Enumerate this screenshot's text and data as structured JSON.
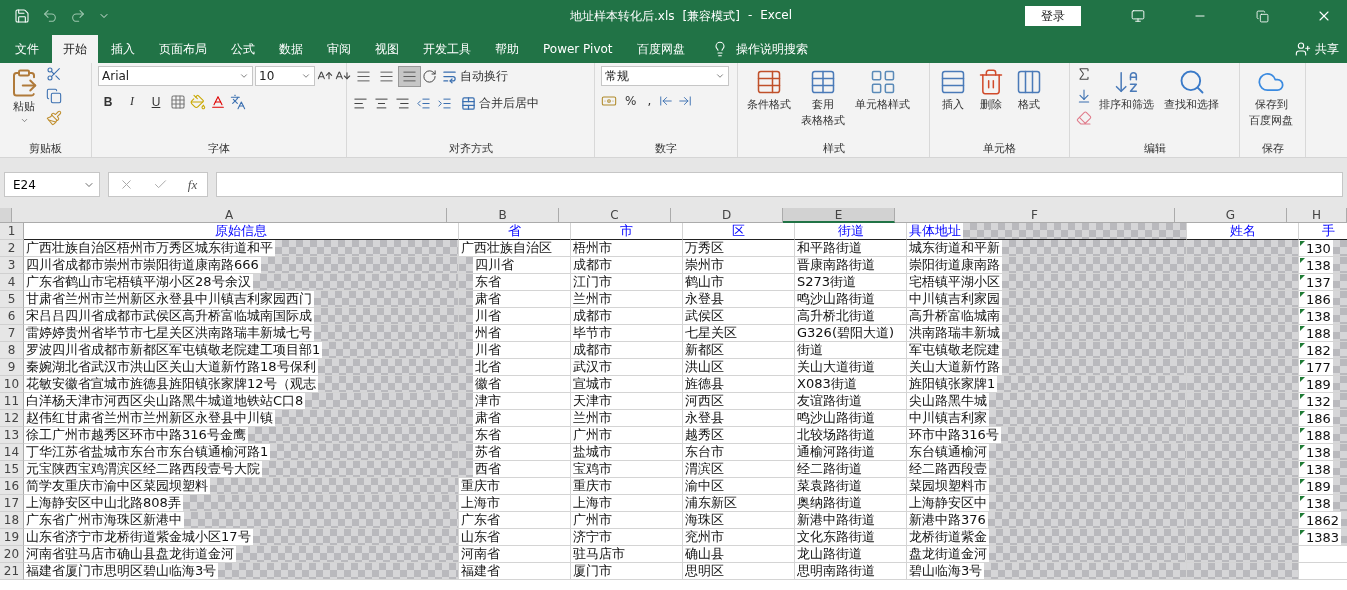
{
  "title_bar": {
    "file_name": "地址样本转化后.xls",
    "mode": "[兼容模式]",
    "separator": "-",
    "app": "Excel",
    "sign_in": "登录"
  },
  "tabs": [
    {
      "label": "文件",
      "selected": false
    },
    {
      "label": "开始",
      "selected": true
    },
    {
      "label": "插入",
      "selected": false
    },
    {
      "label": "页面布局",
      "selected": false
    },
    {
      "label": "公式",
      "selected": false
    },
    {
      "label": "数据",
      "selected": false
    },
    {
      "label": "审阅",
      "selected": false
    },
    {
      "label": "视图",
      "selected": false
    },
    {
      "label": "开发工具",
      "selected": false
    },
    {
      "label": "帮助",
      "selected": false
    },
    {
      "label": "Power Pivot",
      "selected": false
    },
    {
      "label": "百度网盘",
      "selected": false
    }
  ],
  "tell_me": "操作说明搜索",
  "share": "共享",
  "clipboard": {
    "title": "剪贴板",
    "paste": "粘贴"
  },
  "font": {
    "title": "字体",
    "name": "Arial",
    "size": "10",
    "bold": "B",
    "italic": "I",
    "underline": "U"
  },
  "alignment": {
    "title": "对齐方式",
    "wrap": "自动换行",
    "merge": "合并后居中",
    "vertical_buttons": [
      {
        "selected": false
      },
      {
        "selected": false
      },
      {
        "selected": true
      }
    ]
  },
  "number": {
    "title": "数字",
    "format": "常规",
    "percent": "%",
    "comma": ","
  },
  "styles": {
    "title": "样式",
    "buttons": [
      {
        "lines": [
          "条件格式"
        ]
      },
      {
        "lines": [
          "套用",
          "表格格式"
        ]
      },
      {
        "lines": [
          "单元格样式"
        ]
      }
    ]
  },
  "cells": {
    "title": "单元格",
    "buttons": [
      "插入",
      "删除",
      "格式"
    ]
  },
  "editing": {
    "title": "编辑",
    "buttons": [
      "排序和筛选",
      "查找和选择"
    ]
  },
  "save": {
    "title": "保存",
    "lines": [
      "保存到",
      "百度网盘"
    ]
  },
  "formula_bar": {
    "name_box": "E24",
    "fx": "fx"
  },
  "sheet": {
    "columns": [
      {
        "label": "A",
        "selected": false
      },
      {
        "label": "B",
        "selected": false
      },
      {
        "label": "C",
        "selected": false
      },
      {
        "label": "D",
        "selected": false
      },
      {
        "label": "E",
        "selected": true
      },
      {
        "label": "F",
        "selected": false
      },
      {
        "label": "G",
        "selected": false
      },
      {
        "label": "H",
        "selected": false
      }
    ],
    "rows": [
      {
        "num": "1",
        "cells": [
          {
            "text": "原始信息"
          },
          {
            "text": "省"
          },
          {
            "text": "市"
          },
          {
            "text": "区"
          },
          {
            "text": "街道"
          },
          {
            "text": "具体地址",
            "redacted": true
          },
          {
            "text": "姓名"
          },
          {
            "text": "手"
          }
        ]
      },
      {
        "num": "2",
        "cells": [
          {
            "text": "广西壮族自治区梧州市万秀区城东街道和平",
            "redacted": true
          },
          {
            "text": "广西壮族自治区"
          },
          {
            "text": "梧州市"
          },
          {
            "text": "万秀区"
          },
          {
            "text": "和平路街道"
          },
          {
            "text": "城东街道和平新",
            "redacted": true
          },
          {
            "redacted": true
          },
          {
            "text": "130",
            "redacted": true
          }
        ]
      },
      {
        "num": "3",
        "cells": [
          {
            "text": "四川省成都市崇州市崇阳街道康南路666",
            "redacted": true
          },
          {
            "text": "四川省",
            "redacted": true
          },
          {
            "text": "成都市"
          },
          {
            "text": "崇州市"
          },
          {
            "text": "晋康南路街道"
          },
          {
            "text": "崇阳街道康南路",
            "redacted": true
          },
          {
            "redacted": true
          },
          {
            "text": "138",
            "redacted": true
          }
        ]
      },
      {
        "num": "4",
        "cells": [
          {
            "text": "广东省鹤山市宅梧镇平湖小区28号余汉",
            "redacted": true
          },
          {
            "text": "东省",
            "redacted": true
          },
          {
            "text": "江门市"
          },
          {
            "text": "鹤山市"
          },
          {
            "text": "S273街道"
          },
          {
            "text": "宅梧镇平湖小区",
            "redacted": true
          },
          {
            "redacted": true
          },
          {
            "text": "137",
            "redacted": true
          }
        ]
      },
      {
        "num": "5",
        "cells": [
          {
            "text": "甘肃省兰州市兰州新区永登县中川镇吉利家园西门",
            "redacted": true
          },
          {
            "text": "肃省",
            "redacted": true
          },
          {
            "text": "兰州市"
          },
          {
            "text": "永登县"
          },
          {
            "text": "鸣沙山路街道"
          },
          {
            "text": "中川镇吉利家园",
            "redacted": true
          },
          {
            "redacted": true
          },
          {
            "text": "186",
            "redacted": true
          }
        ]
      },
      {
        "num": "6",
        "cells": [
          {
            "text": "宋吕吕四川省成都市武侯区高升桥富临城南国际成",
            "redacted": true
          },
          {
            "text": "川省",
            "redacted": true
          },
          {
            "text": "成都市"
          },
          {
            "text": "武侯区"
          },
          {
            "text": "高升桥北街道"
          },
          {
            "text": "高升桥富临城南",
            "redacted": true
          },
          {
            "redacted": true
          },
          {
            "text": "138",
            "redacted": true
          }
        ]
      },
      {
        "num": "7",
        "cells": [
          {
            "text": "雷婷婷贵州省毕节市七星关区洪南路瑞丰新城七号",
            "redacted": true
          },
          {
            "text": "州省",
            "redacted": true
          },
          {
            "text": "毕节市"
          },
          {
            "text": "七星关区"
          },
          {
            "text": "G326(碧阳大道)"
          },
          {
            "text": "洪南路瑞丰新城",
            "redacted": true
          },
          {
            "redacted": true
          },
          {
            "text": "188",
            "redacted": true
          }
        ]
      },
      {
        "num": "8",
        "cells": [
          {
            "text": "罗波四川省成都市新都区军屯镇敬老院建工项目部1",
            "redacted": true
          },
          {
            "text": "川省",
            "redacted": true
          },
          {
            "text": "成都市"
          },
          {
            "text": "新都区"
          },
          {
            "text": "街道"
          },
          {
            "text": "军屯镇敬老院建",
            "redacted": true
          },
          {
            "redacted": true
          },
          {
            "text": "182",
            "redacted": true
          }
        ]
      },
      {
        "num": "9",
        "cells": [
          {
            "text": "秦婉湖北省武汉市洪山区关山大道新竹路18号保利",
            "redacted": true
          },
          {
            "text": "北省",
            "redacted": true
          },
          {
            "text": "武汉市"
          },
          {
            "text": "洪山区"
          },
          {
            "text": "关山大道街道"
          },
          {
            "text": "关山大道新竹路",
            "redacted": true
          },
          {
            "redacted": true
          },
          {
            "text": "177",
            "redacted": true
          }
        ]
      },
      {
        "num": "10",
        "cells": [
          {
            "text": "花敏安徽省宣城市旌德县旌阳镇张家牌12号（观志",
            "redacted": true
          },
          {
            "text": "徽省",
            "redacted": true
          },
          {
            "text": "宣城市"
          },
          {
            "text": "旌德县"
          },
          {
            "text": "X083街道"
          },
          {
            "text": "旌阳镇张家牌1",
            "redacted": true
          },
          {
            "redacted": true
          },
          {
            "text": "189",
            "redacted": true
          }
        ]
      },
      {
        "num": "11",
        "cells": [
          {
            "text": "白洋杨天津市河西区尖山路黑牛城道地铁站C口8",
            "redacted": true
          },
          {
            "text": "津市",
            "redacted": true
          },
          {
            "text": "天津市"
          },
          {
            "text": "河西区"
          },
          {
            "text": "友谊路街道"
          },
          {
            "text": "尖山路黑牛城",
            "redacted": true
          },
          {
            "redacted": true
          },
          {
            "text": "132",
            "redacted": true
          }
        ]
      },
      {
        "num": "12",
        "cells": [
          {
            "text": "赵伟红甘肃省兰州市兰州新区永登县中川镇",
            "redacted": true
          },
          {
            "text": "肃省",
            "redacted": true
          },
          {
            "text": "兰州市"
          },
          {
            "text": "永登县"
          },
          {
            "text": "鸣沙山路街道"
          },
          {
            "text": "中川镇吉利家",
            "redacted": true
          },
          {
            "redacted": true
          },
          {
            "text": "186",
            "redacted": true
          }
        ]
      },
      {
        "num": "13",
        "cells": [
          {
            "text": "徐工广州市越秀区环市中路316号金鹰",
            "redacted": true
          },
          {
            "text": "东省",
            "redacted": true
          },
          {
            "text": "广州市"
          },
          {
            "text": "越秀区"
          },
          {
            "text": "北较场路街道"
          },
          {
            "text": "环市中路316号",
            "redacted": true
          },
          {
            "redacted": true
          },
          {
            "text": "188",
            "redacted": true
          }
        ]
      },
      {
        "num": "14",
        "cells": [
          {
            "text": "丁华江苏省盐城市东台市东台镇通榆河路1",
            "redacted": true
          },
          {
            "text": "苏省",
            "redacted": true
          },
          {
            "text": "盐城市"
          },
          {
            "text": "东台市"
          },
          {
            "text": "通榆河路街道"
          },
          {
            "text": "东台镇通榆河",
            "redacted": true
          },
          {
            "redacted": true
          },
          {
            "text": "138",
            "redacted": true
          }
        ]
      },
      {
        "num": "15",
        "cells": [
          {
            "text": "元宝陕西宝鸡渭滨区经二路西段壹号大院",
            "redacted": true
          },
          {
            "text": "西省",
            "redacted": true
          },
          {
            "text": "宝鸡市"
          },
          {
            "text": "渭滨区"
          },
          {
            "text": "经二路街道"
          },
          {
            "text": "经二路西段壹",
            "redacted": true
          },
          {
            "redacted": true
          },
          {
            "text": "138",
            "redacted": true
          }
        ]
      },
      {
        "num": "16",
        "cells": [
          {
            "text": "简学友重庆市渝中区菜园坝塑料",
            "redacted": true
          },
          {
            "text": "重庆市"
          },
          {
            "text": "重庆市"
          },
          {
            "text": "渝中区"
          },
          {
            "text": "菜袁路街道"
          },
          {
            "text": "菜园坝塑料市",
            "redacted": true
          },
          {
            "redacted": true
          },
          {
            "text": "189",
            "redacted": true
          }
        ]
      },
      {
        "num": "17",
        "cells": [
          {
            "text": "上海静安区中山北路808弄",
            "redacted": true
          },
          {
            "text": "上海市"
          },
          {
            "text": "上海市"
          },
          {
            "text": "浦东新区"
          },
          {
            "text": "奥纳路街道"
          },
          {
            "text": "上海静安区中",
            "redacted": true
          },
          {
            "redacted": true
          },
          {
            "text": "138",
            "redacted": true
          }
        ]
      },
      {
        "num": "18",
        "cells": [
          {
            "text": "广东省广州市海珠区新港中",
            "redacted": true
          },
          {
            "text": "广东省"
          },
          {
            "text": "广州市"
          },
          {
            "text": "海珠区"
          },
          {
            "text": "新港中路街道"
          },
          {
            "text": "新港中路376",
            "redacted": true
          },
          {
            "redacted": true
          },
          {
            "text": "1862",
            "redacted": true
          }
        ]
      },
      {
        "num": "19",
        "cells": [
          {
            "text": "山东省济宁市龙桥街道紫金城小区17号",
            "redacted": true
          },
          {
            "text": "山东省"
          },
          {
            "text": "济宁市"
          },
          {
            "text": "兖州市"
          },
          {
            "text": "文化东路街道"
          },
          {
            "text": "龙桥街道紫金",
            "redacted": true
          },
          {
            "redacted": true
          },
          {
            "text": "1383",
            "redacted": true
          }
        ]
      },
      {
        "num": "20",
        "cells": [
          {
            "text": "河南省驻马店市确山县盘龙街道金河",
            "redacted": true
          },
          {
            "text": "河南省"
          },
          {
            "text": "驻马店市"
          },
          {
            "text": "确山县"
          },
          {
            "text": "龙山路街道"
          },
          {
            "text": "盘龙街道金河",
            "redacted": true
          },
          {
            "redacted": true
          },
          {}
        ]
      },
      {
        "num": "21",
        "cells": [
          {
            "text": "福建省厦门市思明区碧山临海3号",
            "redacted": true
          },
          {
            "text": "福建省"
          },
          {
            "text": "厦门市"
          },
          {
            "text": "思明区"
          },
          {
            "text": "思明南路街道"
          },
          {
            "text": "碧山临海3号",
            "redacted": true
          },
          {
            "redacted": true
          },
          {}
        ]
      }
    ]
  }
}
